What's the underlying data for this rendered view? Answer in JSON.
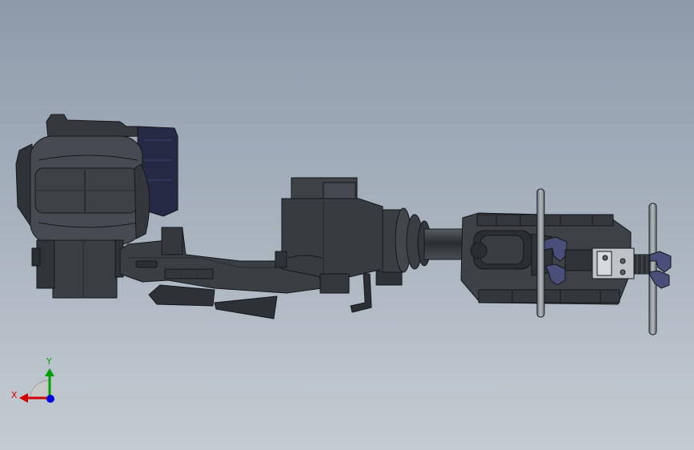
{
  "viewport": {
    "background_top": "#8c9aaa",
    "background_bottom": "#c5cbd2"
  },
  "model": {
    "body_color": "#3e4146",
    "dark_color": "#2d3035",
    "edge_color": "#16181b",
    "accent_color": "#262a45",
    "rod_color": "#8a8f94",
    "gripper_color": "#4a4f7a"
  },
  "triad": {
    "x_label": "X",
    "y_label": "Y",
    "x_color": "#d00000",
    "y_color": "#00a000",
    "z_color": "#0000e0",
    "icon": "coordinate-triad-icon"
  }
}
